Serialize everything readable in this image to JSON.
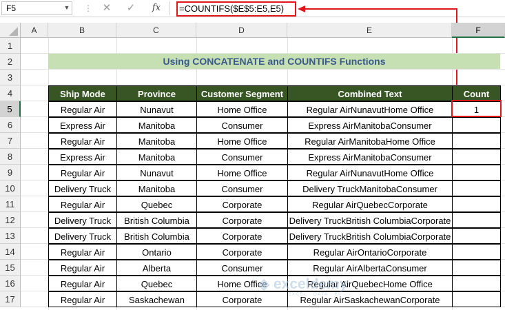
{
  "formula_bar": {
    "name_box": "F5",
    "formula": "=COUNTIFS($E$5:E5,E5)",
    "fx_label": "fx",
    "cancel_glyph": "✕",
    "enter_glyph": "✓"
  },
  "columns": [
    "A",
    "B",
    "C",
    "D",
    "E",
    "F"
  ],
  "selected_column": "F",
  "rows": [
    "1",
    "2",
    "3",
    "4",
    "5",
    "6",
    "7",
    "8",
    "9",
    "10",
    "11",
    "12",
    "13",
    "14",
    "15",
    "16",
    "17"
  ],
  "selected_row": "5",
  "title": "Using CONCATENATE and COUNTIFS Functions",
  "table": {
    "headers": [
      "Ship Mode",
      "Province",
      "Customer Segment",
      "Combined Text",
      "Count"
    ],
    "rows": [
      [
        "Regular Air",
        "Nunavut",
        "Home Office",
        "Regular AirNunavutHome Office",
        "1"
      ],
      [
        "Express Air",
        "Manitoba",
        "Consumer",
        "Express AirManitobaConsumer",
        ""
      ],
      [
        "Regular Air",
        "Manitoba",
        "Home Office",
        "Regular AirManitobaHome Office",
        ""
      ],
      [
        "Express Air",
        "Manitoba",
        "Consumer",
        "Express AirManitobaConsumer",
        ""
      ],
      [
        "Regular Air",
        "Nunavut",
        "Home Office",
        "Regular AirNunavutHome Office",
        ""
      ],
      [
        "Delivery Truck",
        "Manitoba",
        "Consumer",
        "Delivery TruckManitobaConsumer",
        ""
      ],
      [
        "Regular Air",
        "Quebec",
        "Corporate",
        "Regular AirQuebecCorporate",
        ""
      ],
      [
        "Delivery Truck",
        "British Columbia",
        "Corporate",
        "Delivery TruckBritish ColumbiaCorporate",
        ""
      ],
      [
        "Delivery Truck",
        "British Columbia",
        "Corporate",
        "Delivery TruckBritish ColumbiaCorporate",
        ""
      ],
      [
        "Regular Air",
        "Ontario",
        "Corporate",
        "Regular AirOntarioCorporate",
        ""
      ],
      [
        "Regular Air",
        "Alberta",
        "Consumer",
        "Regular AirAlbertaConsumer",
        ""
      ],
      [
        "Regular Air",
        "Quebec",
        "Home Office",
        "Regular AirQuebecHome Office",
        ""
      ],
      [
        "Regular Air",
        "Saskachewan",
        "Corporate",
        "Regular AirSaskachewanCorporate",
        ""
      ]
    ]
  },
  "watermark": {
    "name": "exceldemy",
    "tagline": "EXCEL · DATA · BI"
  },
  "colors": {
    "header_fill": "#375623",
    "title_fill": "#c6e0b4",
    "title_text": "#3a5a8a",
    "highlight": "#e2151a",
    "selection": "#217346"
  }
}
